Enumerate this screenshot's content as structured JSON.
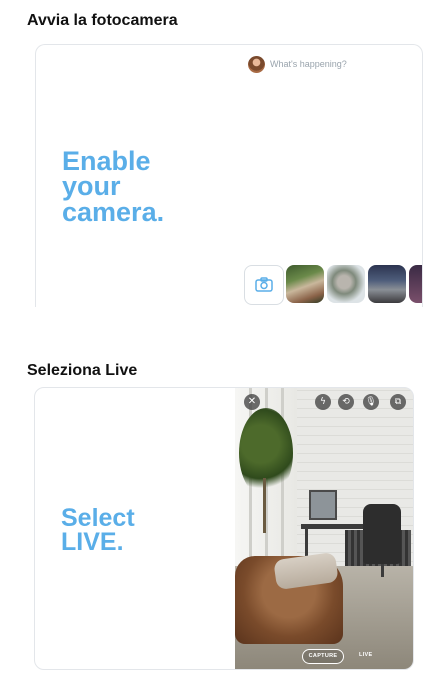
{
  "sections": [
    {
      "title": "Avvia la fotocamera",
      "compose_placeholder": "What's happening?",
      "headline": [
        "Enable",
        "your",
        "camera."
      ]
    },
    {
      "title": "Seleziona Live",
      "headline": [
        "Select",
        "LIVE."
      ],
      "camera_controls": [
        "close-icon",
        "flash-icon",
        "flip-camera-icon",
        "microphone-icon",
        "gallery-icon"
      ],
      "modes": [
        "CAPTURE",
        "LIVE"
      ]
    }
  ],
  "colors": {
    "headline": "#5aaee8",
    "card_border": "#e3e6ea",
    "title": "#111111"
  }
}
